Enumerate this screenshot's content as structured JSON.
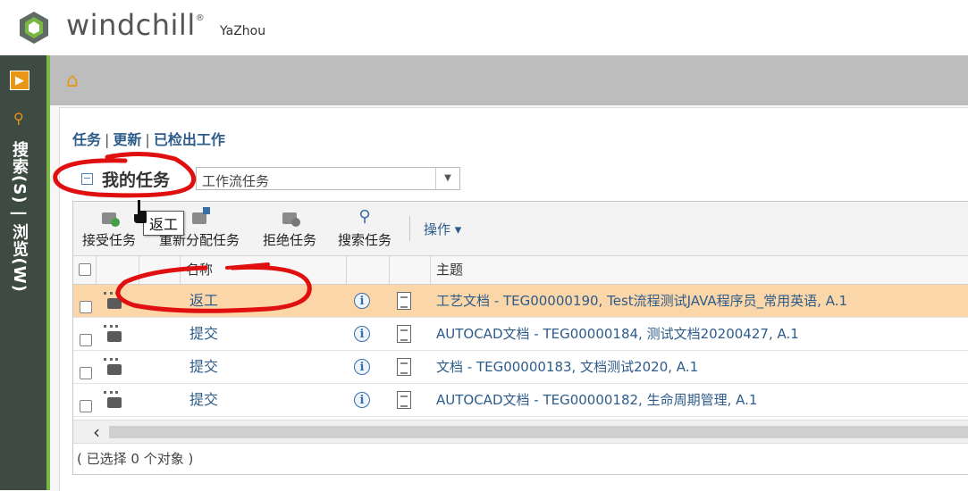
{
  "header": {
    "brand": "windchill",
    "trademark": "®",
    "user": "YaZhou"
  },
  "nav": {
    "vertical_label": "搜索(S) | 浏览(W)"
  },
  "links": [
    "任务",
    "更新",
    "已检出工作"
  ],
  "my_tasks": {
    "label": "我的任务",
    "collapse_symbol": "−",
    "select_value": "工作流任务"
  },
  "toolbar": {
    "buttons": [
      "接受任务",
      "重新分配任务",
      "拒绝任务",
      "搜索任务"
    ],
    "actions": "操作 ▾"
  },
  "table": {
    "columns": [
      "名称",
      "主题"
    ],
    "rows": [
      {
        "name": "返工",
        "subject": "工艺文档 - TEG00000190, Test流程测试JAVA程序员_常用英语, A.1",
        "selected": true
      },
      {
        "name": "提交",
        "subject": "AUTOCAD文档 - TEG00000184, 测试文档20200427, A.1",
        "selected": false
      },
      {
        "name": "提交",
        "subject": "文档 - TEG00000183, 文档测试2020, A.1",
        "selected": false
      },
      {
        "name": "提交",
        "subject": "AUTOCAD文档 - TEG00000182, 生命周期管理, A.1",
        "selected": false
      }
    ]
  },
  "tooltip": "返工",
  "footer": "( 已选择 0 个对象 )",
  "colors": {
    "accent_orange": "#e79617",
    "nav_green": "#79b843",
    "link_blue": "#2e5c8a",
    "selected_row": "#fbd6a8",
    "annotation_red": "#e01010"
  }
}
